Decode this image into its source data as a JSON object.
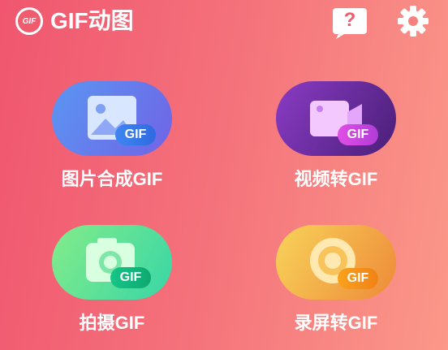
{
  "header": {
    "app_logo_text": "GIF",
    "app_title": "GIF动图",
    "help_symbol": "?"
  },
  "features": [
    {
      "label": "图片合成GIF",
      "badge": "GIF",
      "icon": "image-icon"
    },
    {
      "label": "视频转GIF",
      "badge": "GIF",
      "icon": "video-icon"
    },
    {
      "label": "拍摄GIF",
      "badge": "GIF",
      "icon": "camera-icon"
    },
    {
      "label": "录屏转GIF",
      "badge": "GIF",
      "icon": "screen-record-icon"
    }
  ],
  "colors": {
    "background_start": "#f0566f",
    "background_end": "#fb9889",
    "image_tile": "#6a7ff0",
    "video_tile": "#6a2fa0",
    "camera_tile": "#6fe08f",
    "record_tile": "#f5b030"
  }
}
